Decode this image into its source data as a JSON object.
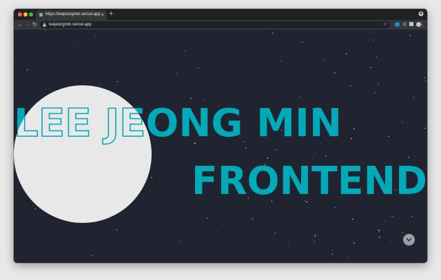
{
  "browser": {
    "tab_title": "https://leejeongmin.vercel.app",
    "new_tab_symbol": "+",
    "close_tab_symbol": "×",
    "url": "leejeongmin.vercel.app"
  },
  "hero": {
    "name": "LEE JEONG MIN",
    "role": "FRONTEND",
    "accent_color": "#00aab8",
    "circle_color": "#e8e8e8",
    "background_color": "#1f2430"
  },
  "icons": {
    "scroll_down": "chevron-down-icon",
    "back": "arrow-left-icon",
    "forward": "arrow-right-icon",
    "reload": "reload-icon",
    "bookmark": "star-icon",
    "menu": "more-vertical-icon"
  }
}
